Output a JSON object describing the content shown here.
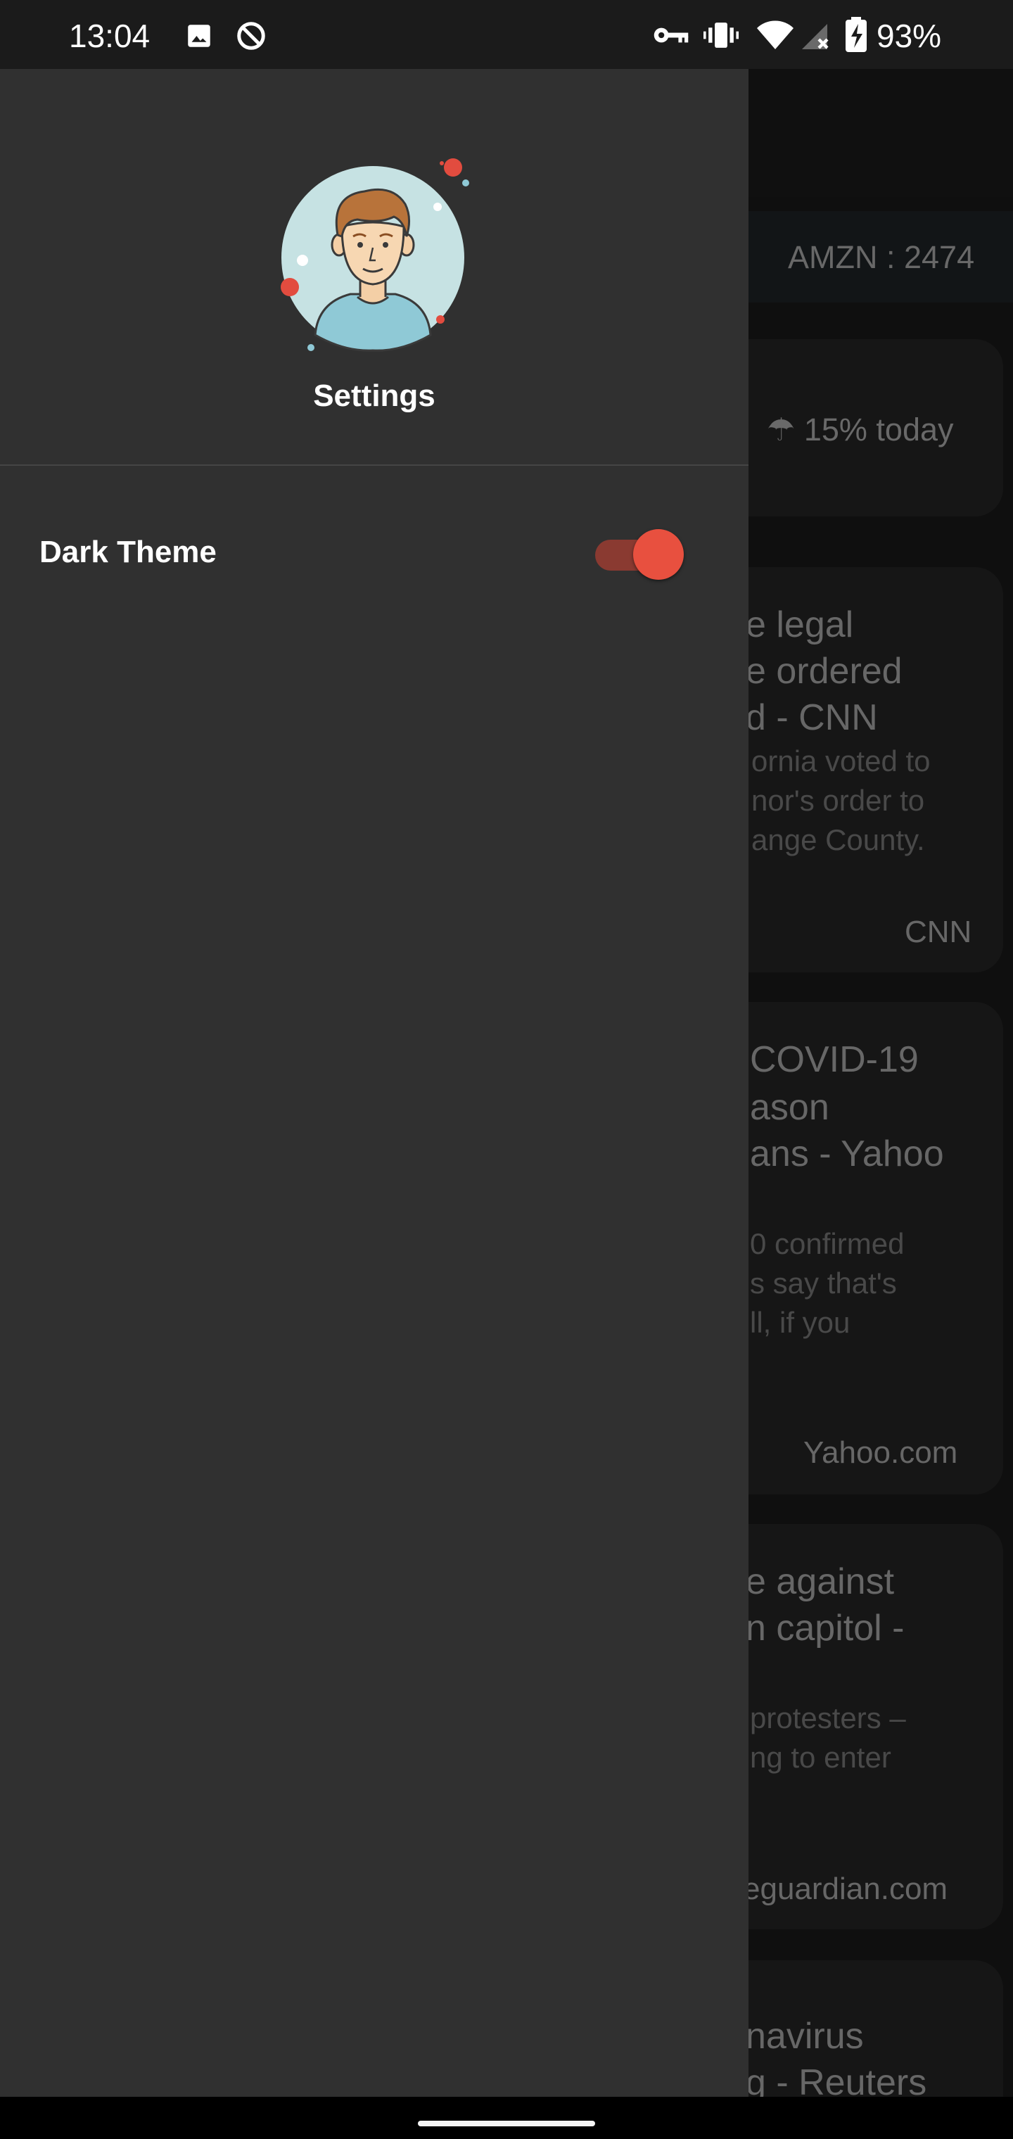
{
  "status_bar": {
    "time": "13:04",
    "battery": "93%",
    "icons": [
      "image-icon",
      "do-not-disturb-icon",
      "vpn-key-icon",
      "vibrate-icon",
      "wifi-icon",
      "cellular-no-signal-icon",
      "battery-charging-icon"
    ]
  },
  "drawer": {
    "title": "Settings",
    "settings": [
      {
        "label": "Dark Theme",
        "enabled": true
      }
    ],
    "accent_color": "#e8503f"
  },
  "background": {
    "ticker": "AMZN : 2474",
    "weather": "☂ 15% today",
    "cards": [
      {
        "title_lines": [
          "e legal",
          "e ordered",
          "d - CNN"
        ],
        "desc_lines": [
          "ornia voted to",
          "nor's order to",
          "ange County."
        ],
        "source": "CNN"
      },
      {
        "title_lines": [
          "COVID-19",
          "ason",
          "ans - Yahoo"
        ],
        "desc_lines": [
          "0 confirmed",
          "s say that's",
          "ll, if you"
        ],
        "source": "Yahoo.com"
      },
      {
        "title_lines": [
          "e against",
          "n capitol -"
        ],
        "desc_lines": [
          "protesters –",
          "ng to enter"
        ],
        "source": "eguardian.com"
      },
      {
        "title_lines": [
          "navirus",
          "g - Reuters"
        ],
        "desc_lines": [],
        "source": ""
      }
    ]
  }
}
